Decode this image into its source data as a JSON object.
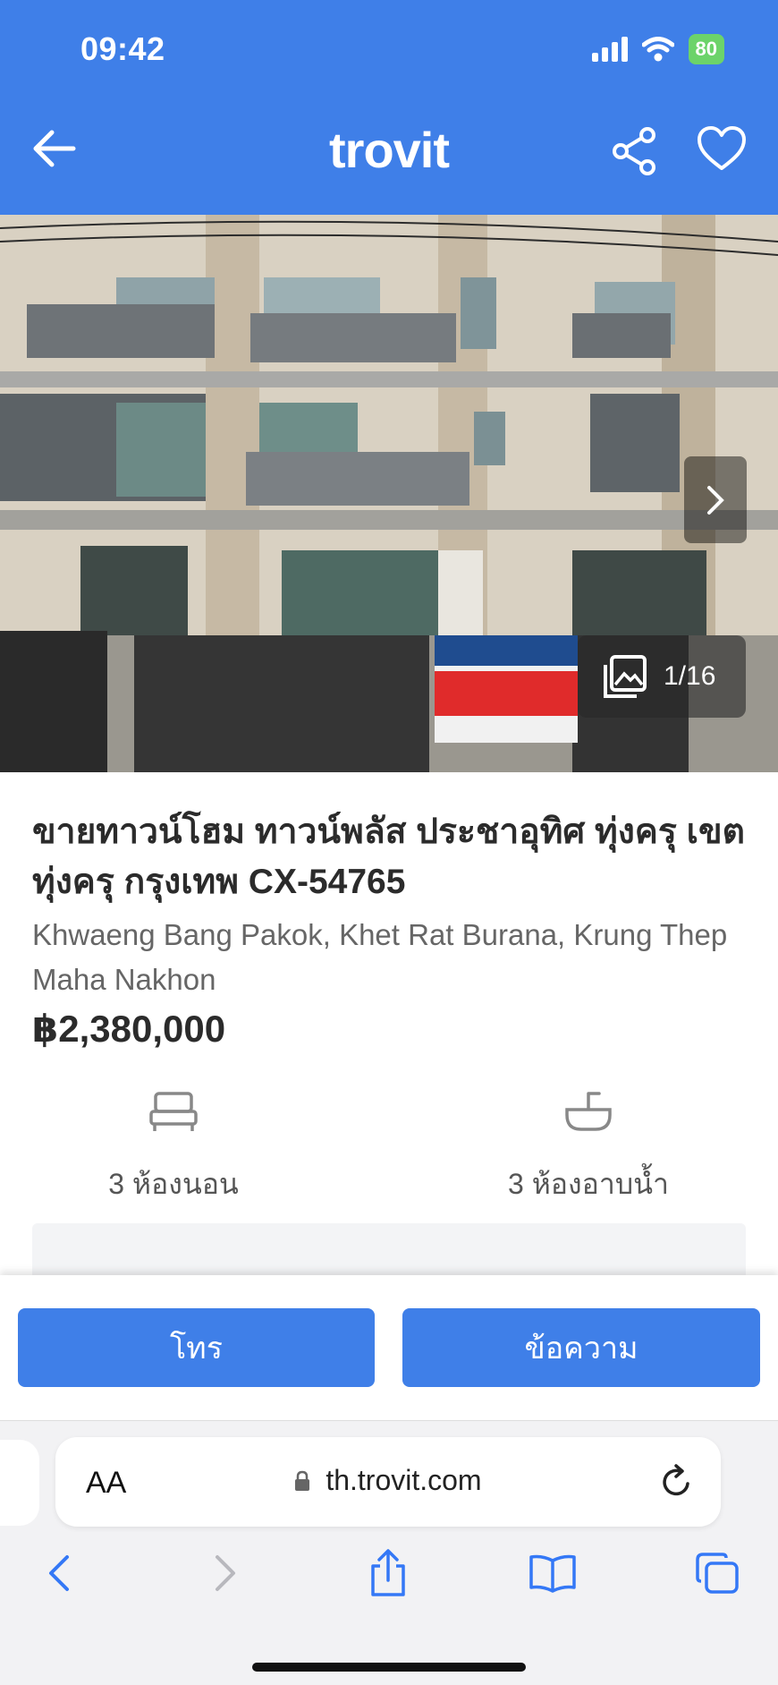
{
  "status": {
    "time": "09:42",
    "battery": "80"
  },
  "header": {
    "brand": "trovit"
  },
  "gallery": {
    "counter": "1/16"
  },
  "listing": {
    "title": "ขายทาวน์โฮม ทาวน์พลัส ประชาอุทิศ ทุ่งครุ เขต ทุ่งครุ กรุงเทพ CX-54765",
    "address": "Khwaeng Bang Pakok, Khet Rat Burana, Krung Thep Maha Nakhon",
    "price": "฿2,380,000",
    "features": {
      "bedrooms": "3 ห้องนอน",
      "bathrooms": "3 ห้องอาบน้ำ"
    }
  },
  "actions": {
    "call": "โทร",
    "message": "ข้อความ"
  },
  "browser": {
    "aa": "AA",
    "url": "th.trovit.com"
  },
  "colors": {
    "brand_blue": "#3f7fe8",
    "safari_blue": "#3478f6"
  }
}
